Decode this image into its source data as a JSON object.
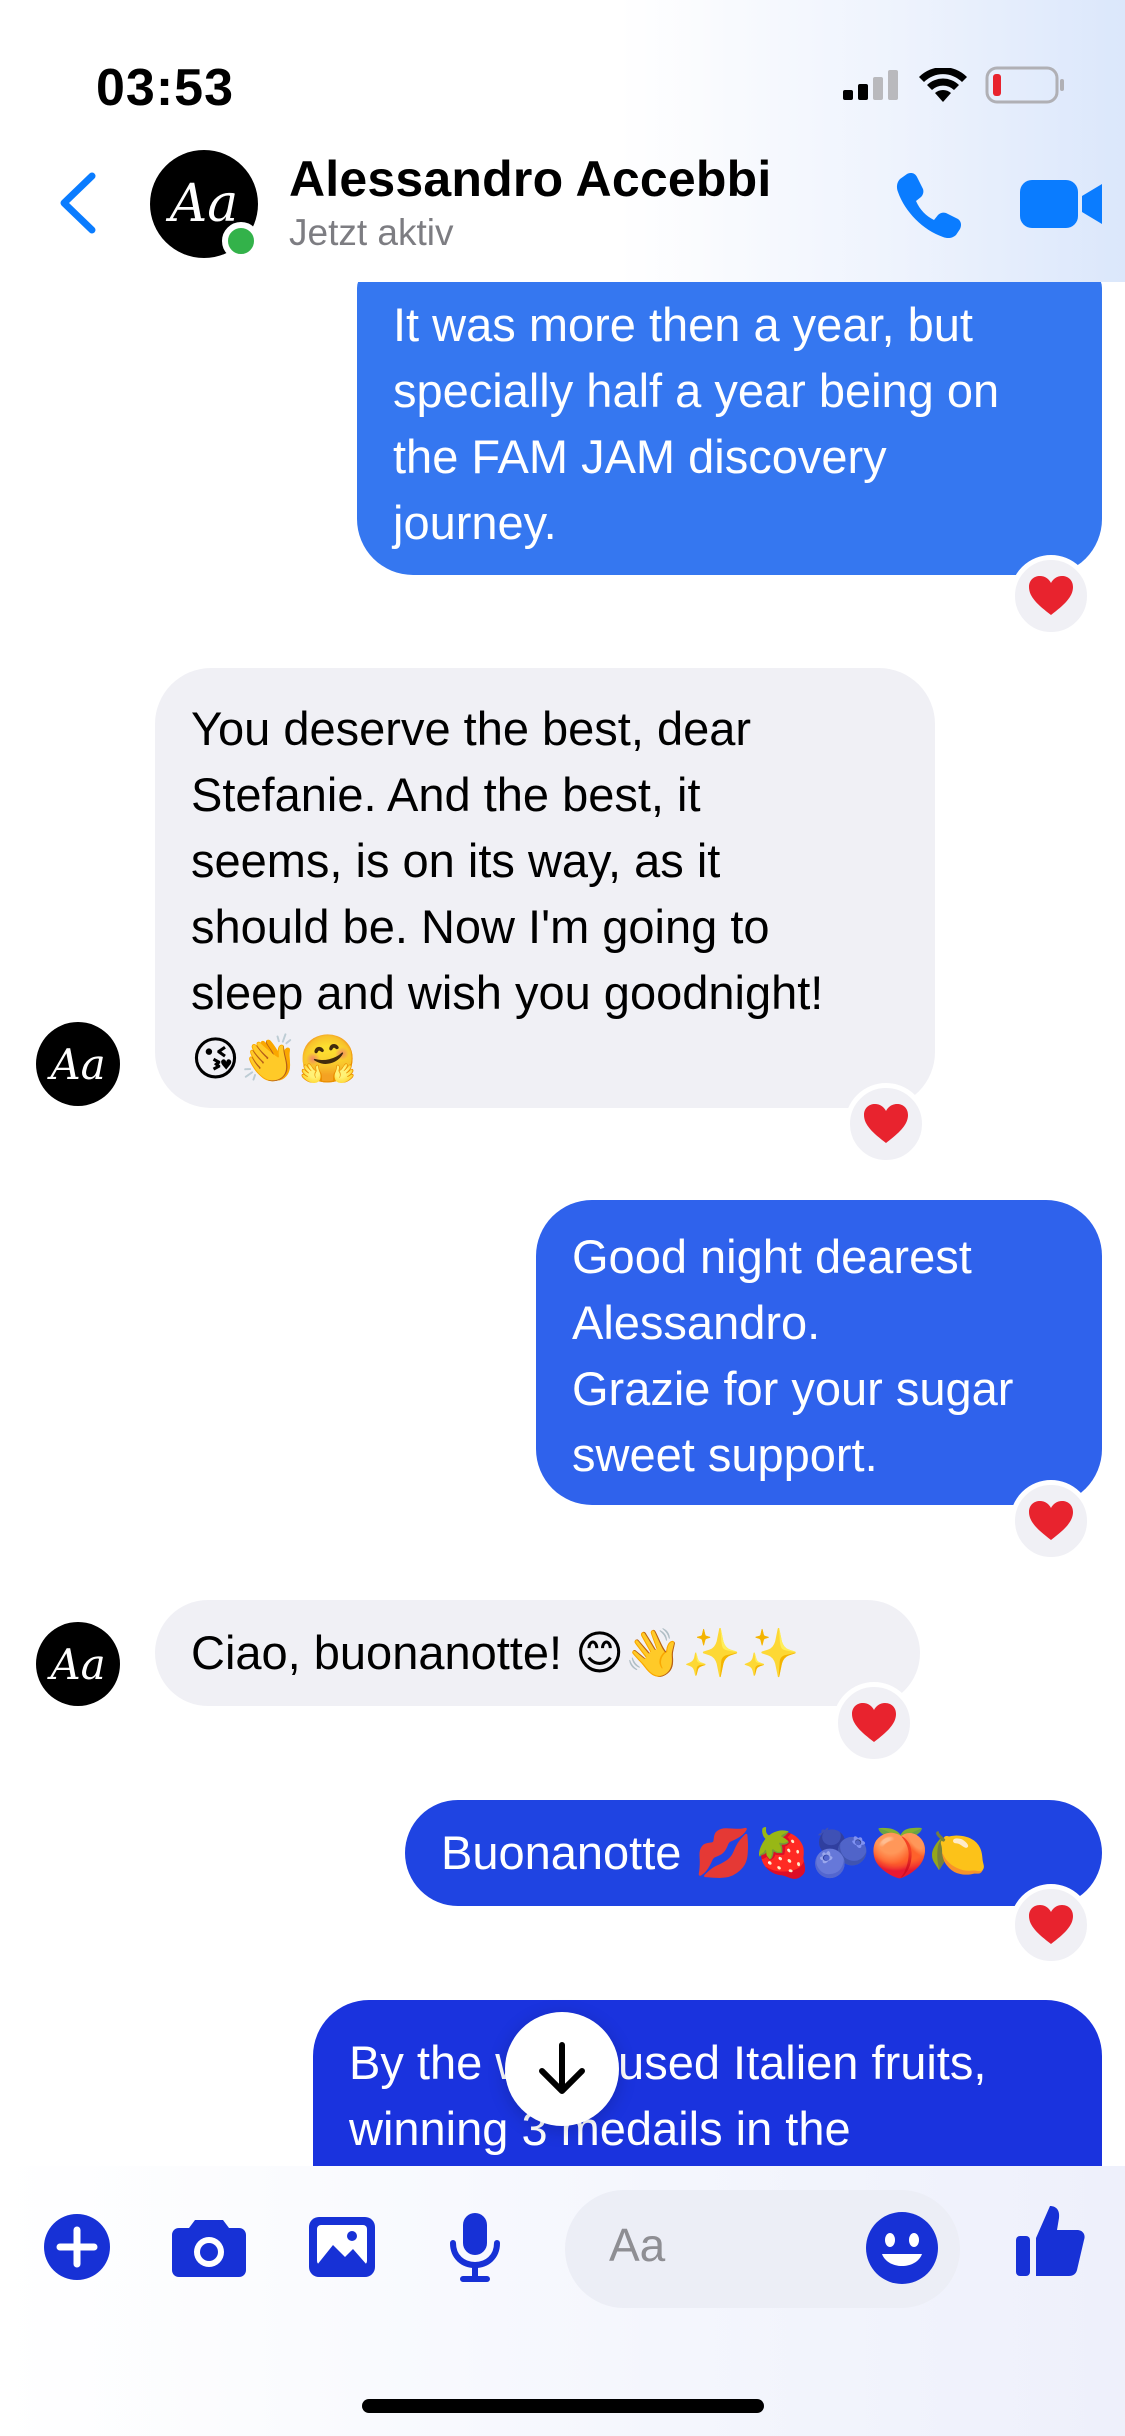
{
  "status_bar": {
    "time": "03:53"
  },
  "header": {
    "avatar_text": "Aa",
    "contact_name": "Alessandro Accebbi",
    "contact_status": "Jetzt aktiv"
  },
  "messages": [
    {
      "direction": "outgoing",
      "text": "It was more then a year, but\nspecially half a year being on\nthe FAM JAM discovery\njourney.",
      "reaction": "heart"
    },
    {
      "direction": "incoming",
      "text": "You deserve the best, dear\nStefanie. And the best, it\nseems, is on its way, as it\nshould be. Now I'm going to\nsleep and wish you goodnight!\n😘👏🤗",
      "reaction": "heart"
    },
    {
      "direction": "outgoing",
      "text": "Good night dearest\nAlessandro.\nGrazie for your sugar\nsweet support.",
      "reaction": "heart"
    },
    {
      "direction": "incoming",
      "text": "Ciao, buonanotte! 😊👋✨✨",
      "reaction": "heart"
    },
    {
      "direction": "outgoing",
      "text": "Buonanotte 💋🍓🫐🍑🍋",
      "reaction": "heart"
    },
    {
      "direction": "outgoing",
      "text": "By the way I used Italien fruits,\nwinning 3 medails in the",
      "reaction": null
    }
  ],
  "composer": {
    "placeholder": "Aa"
  },
  "colors": {
    "accent": "#0a7cff",
    "composer_icons": "#1731d6",
    "heart": "#e8232e"
  },
  "icons": [
    "back-chevron-icon",
    "phone-icon",
    "video-camera-icon",
    "plus-icon",
    "camera-icon",
    "gallery-icon",
    "microphone-icon",
    "emoji-icon",
    "thumbs-up-icon",
    "arrow-down-icon",
    "heart-icon"
  ]
}
